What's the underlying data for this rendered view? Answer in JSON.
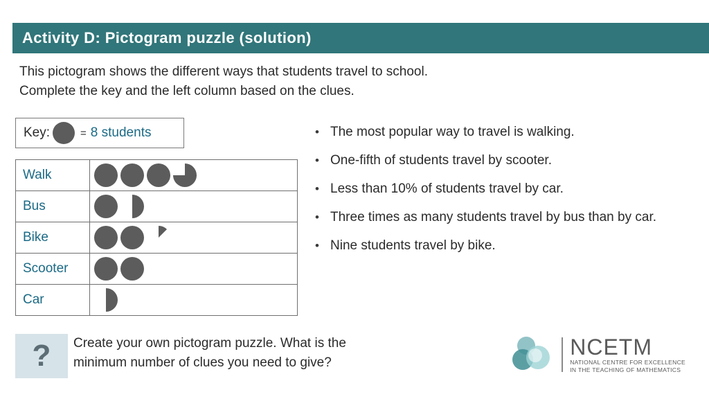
{
  "title": {
    "text": "Activity D: Pictogram puzzle (solution)",
    "bar_color": "#31767a"
  },
  "intro": {
    "line1": "This pictogram shows the different ways that students travel to school.",
    "line2": "Complete the key and the left column based on the clues."
  },
  "key": {
    "label": "Key:",
    "equals": "=",
    "value": "8 students",
    "symbol": "filled-circle",
    "value_color": "#1b6a86"
  },
  "pictogram": {
    "symbol_color": "#5c5c5c",
    "rows": [
      {
        "label": "Walk",
        "full": 3,
        "fraction": 0.75
      },
      {
        "label": "Bus",
        "full": 1,
        "fraction": 0.5
      },
      {
        "label": "Bike",
        "full": 2,
        "fraction": 0.125
      },
      {
        "label": "Scooter",
        "full": 2,
        "fraction": 0
      },
      {
        "label": "Car",
        "full": 0,
        "fraction": 0.5
      }
    ]
  },
  "clues": {
    "bullet": "•",
    "items": [
      "The most popular way to travel is walking.",
      "One-fifth of students travel by scooter.",
      "Less than 10% of students travel by car.",
      "Three times as many students travel by bus than by car.",
      "Nine students travel by bike."
    ]
  },
  "footer": {
    "icon": "question-mark",
    "icon_glyph": "?",
    "line1": "Create your own pictogram puzzle. What is the",
    "line2": "minimum number of clues you need to give?"
  },
  "logo": {
    "name": "NCETM",
    "sub_line1": "NATIONAL CENTRE FOR EXCELLENCE",
    "sub_line2": "IN THE TEACHING OF MATHEMATICS"
  }
}
